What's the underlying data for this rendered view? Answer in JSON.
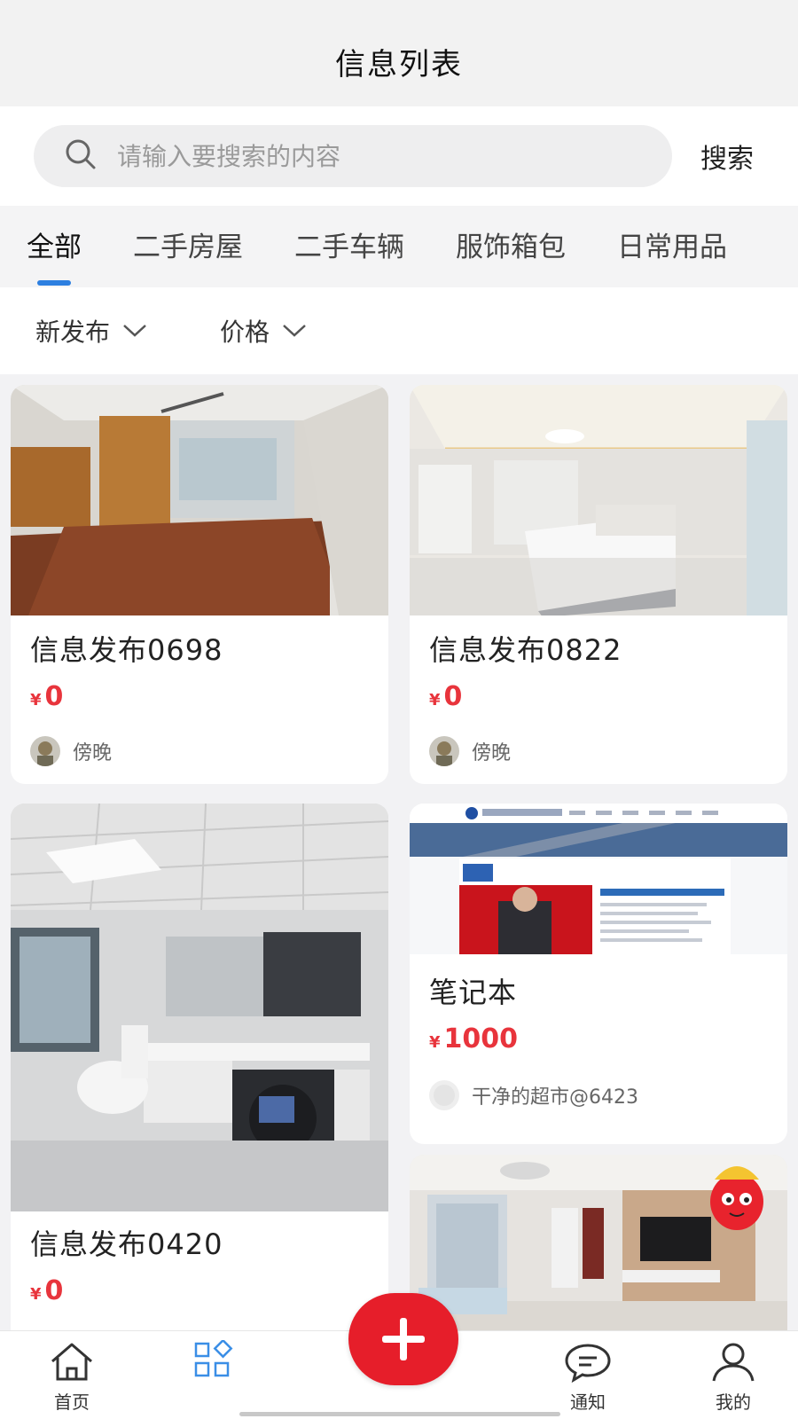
{
  "header": {
    "title": "信息列表"
  },
  "search": {
    "placeholder": "请输入要搜索的内容",
    "button_label": "搜索",
    "icon": "search-icon"
  },
  "tabs": [
    {
      "label": "全部",
      "active": true
    },
    {
      "label": "二手房屋",
      "active": false
    },
    {
      "label": "二手车辆",
      "active": false
    },
    {
      "label": "服饰箱包",
      "active": false
    },
    {
      "label": "日常用品",
      "active": false
    }
  ],
  "filters": [
    {
      "label": "新发布",
      "icon": "chevron-down-icon"
    },
    {
      "label": "价格",
      "icon": "chevron-down-icon"
    }
  ],
  "listings": [
    {
      "title": "信息发布0698",
      "currency": "¥",
      "price": "0",
      "seller": "傍晚",
      "image": "empty-room"
    },
    {
      "title": "信息发布0822",
      "currency": "¥",
      "price": "0",
      "seller": "傍晚",
      "image": "bedroom"
    },
    {
      "title": "信息发布0420",
      "currency": "¥",
      "price": "0",
      "seller": "",
      "image": "bathroom"
    },
    {
      "title": "笔记本",
      "currency": "¥",
      "price": "1000",
      "seller": "干净的超市@6423",
      "image": "webpage-screenshot"
    },
    {
      "title": "",
      "currency": "",
      "price": "",
      "seller": "",
      "image": "living-room"
    }
  ],
  "bottom_nav": [
    {
      "label": "首页",
      "icon": "home-icon"
    },
    {
      "label": "",
      "icon": "category-icon"
    },
    {
      "label": "",
      "icon": "plus-icon"
    },
    {
      "label": "通知",
      "icon": "chat-bubble-icon"
    },
    {
      "label": "我的",
      "icon": "user-icon"
    }
  ],
  "colors": {
    "accent": "#2d7fe0",
    "price": "#e8343c",
    "fab": "#e61e2a"
  }
}
